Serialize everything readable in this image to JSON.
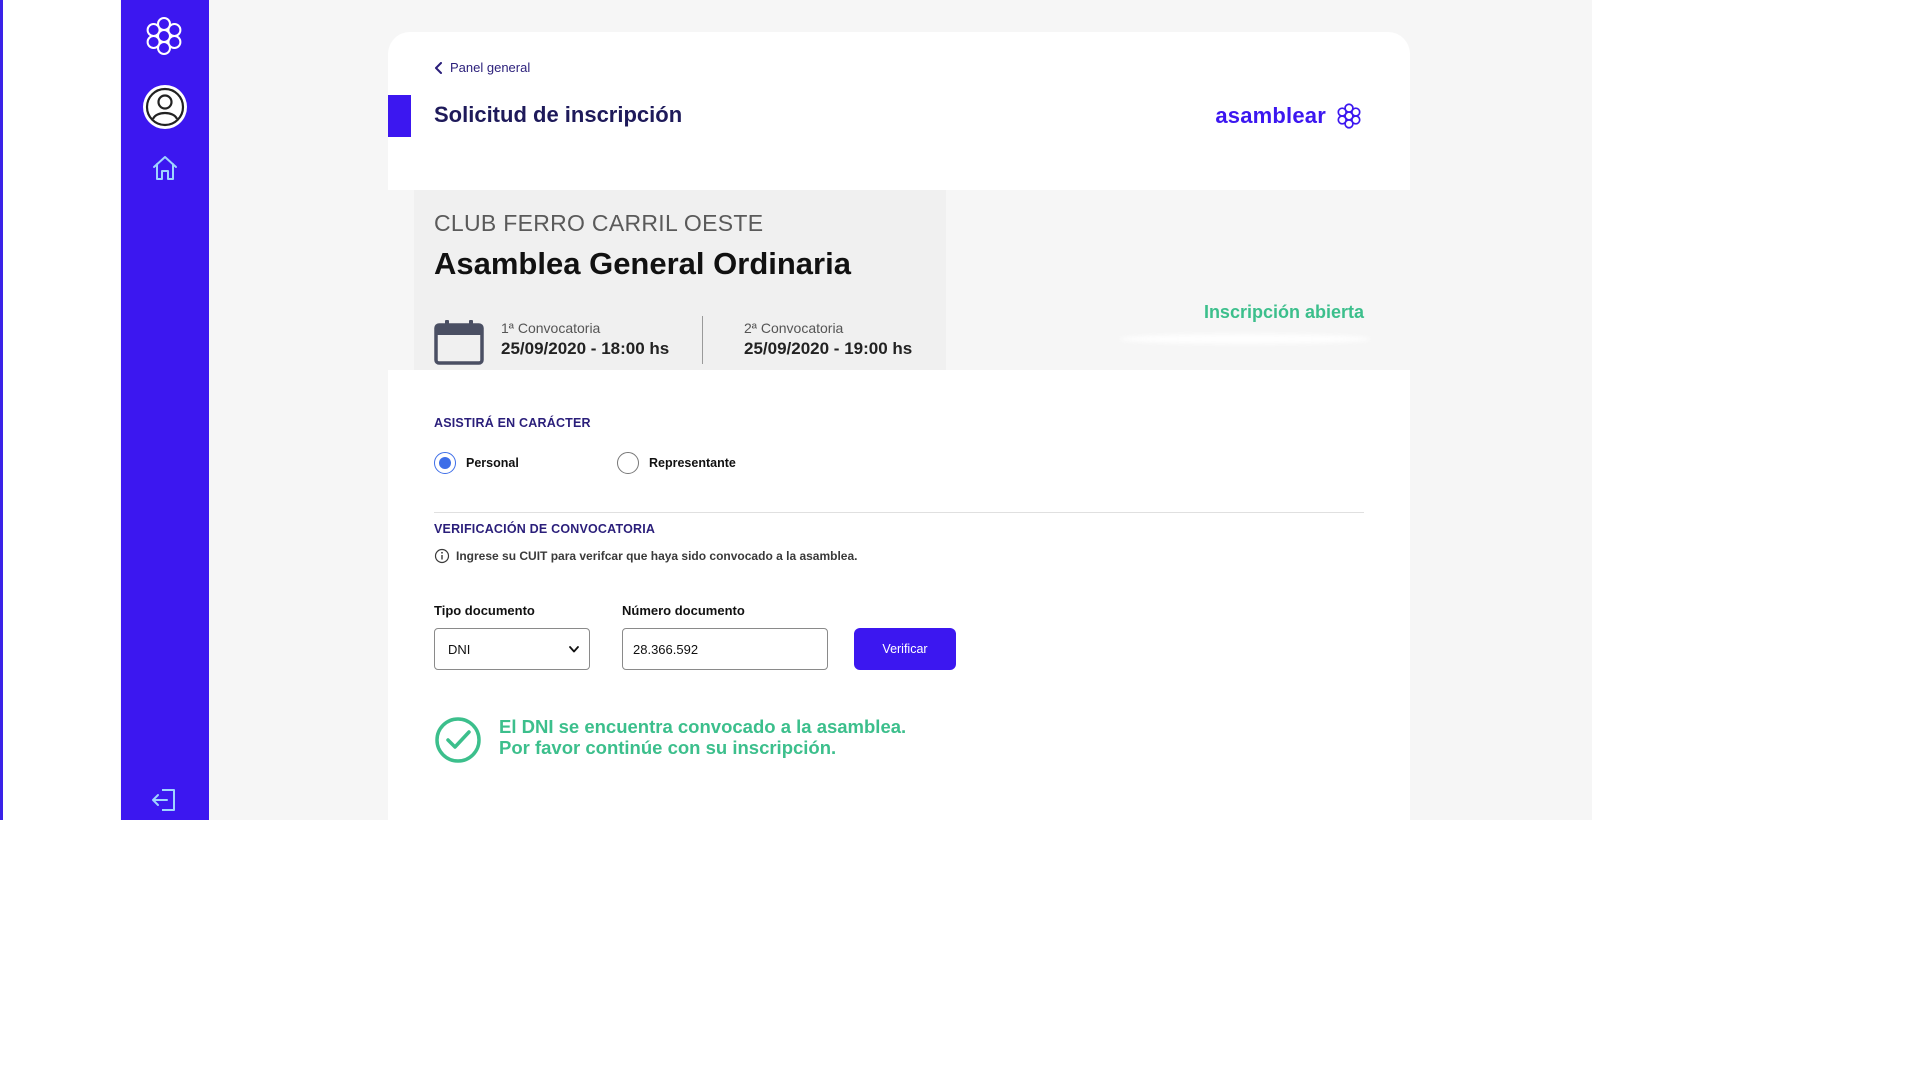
{
  "colors": {
    "brand": "#3c17f0",
    "page_background": "#f6f6f6",
    "success": "#3cbf8c",
    "title": "#1e1a5a",
    "radio_selected": "#3e6ee8"
  },
  "sidebar": {
    "logo_icon": "flower-logo-icon",
    "avatar_icon": "user-avatar-icon",
    "nav": [
      {
        "icon": "home-icon"
      }
    ],
    "logout_icon": "logout-icon"
  },
  "header": {
    "back_label": "Panel general",
    "title": "Solicitud de inscripción",
    "brand_name": "asamblear"
  },
  "event": {
    "organization": "CLUB FERRO CARRIL OESTE",
    "name": "Asamblea General Ordinaria",
    "convocatorias": [
      {
        "label": "1ª Convocatoria",
        "datetime": "25/09/2020 - 18:00 hs"
      },
      {
        "label": "2ª Convocatoria",
        "datetime": "25/09/2020 - 19:00 hs"
      }
    ],
    "status": "Inscripción abierta"
  },
  "attendance": {
    "title": "ASISTIRÁ EN CARÁCTER",
    "options": [
      {
        "label": "Personal",
        "selected": true
      },
      {
        "label": "Representante",
        "selected": false
      }
    ]
  },
  "verification": {
    "title": "VERIFICACIÓN DE CONVOCATORIA",
    "hint": "Ingrese su CUIT para verifcar que haya sido convocado a la asamblea.",
    "doc_type_label": "Tipo documento",
    "doc_type_value": "DNI",
    "doc_number_label": "Número documento",
    "doc_number_value": "28.366.592",
    "button_label": "Verificar",
    "success_line1": "El DNI se encuentra convocado a la asamblea.",
    "success_line2": "Por favor continúe con su inscripción."
  }
}
